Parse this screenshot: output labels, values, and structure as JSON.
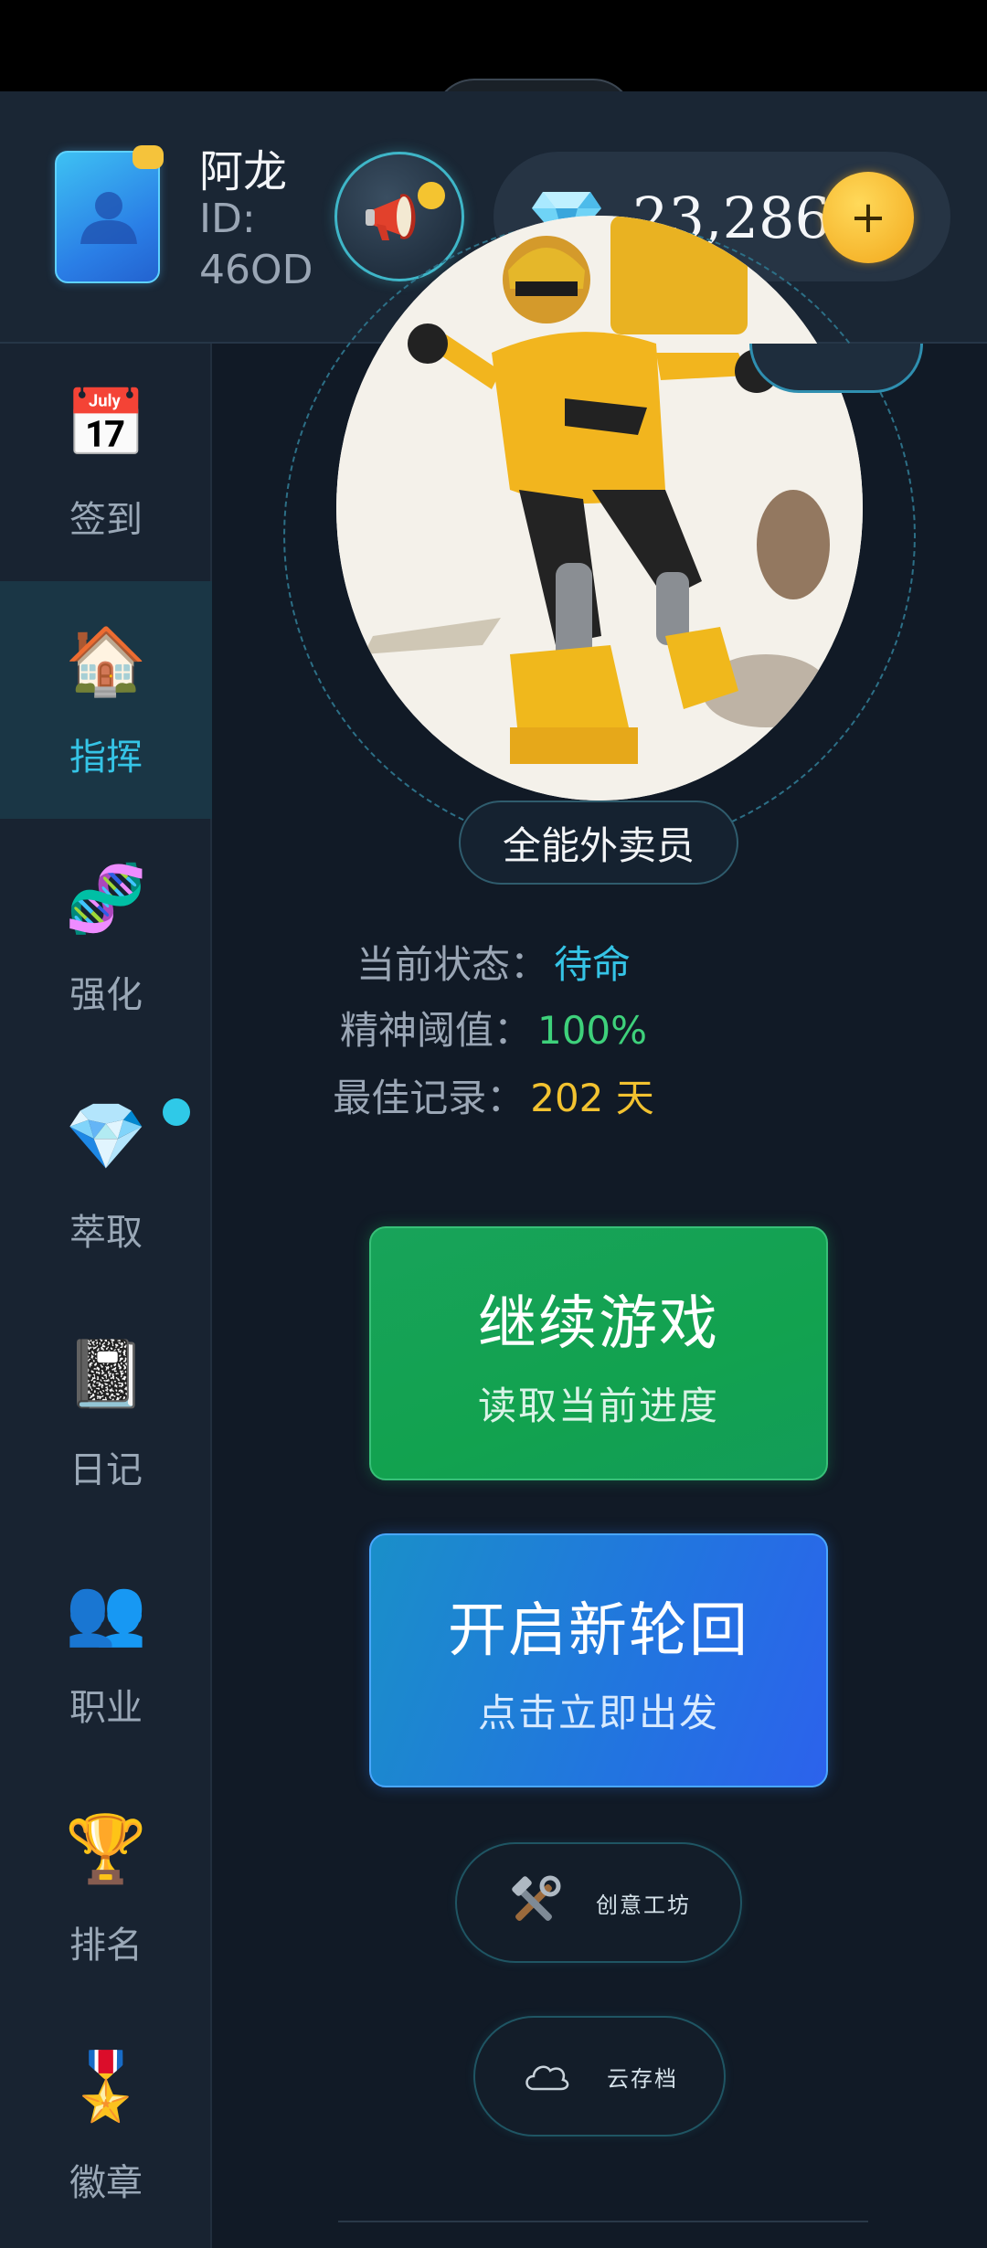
{
  "user": {
    "name": "阿龙",
    "id_label": "ID:",
    "id_value": "46OD"
  },
  "currency": {
    "gems": "23,286",
    "add_label": "+"
  },
  "sidebar": {
    "items": [
      {
        "label": "签到",
        "icon": "calendar-icon",
        "glyph": "📅"
      },
      {
        "label": "指挥",
        "icon": "house-icon",
        "glyph": "🏠",
        "active": true
      },
      {
        "label": "强化",
        "icon": "dna-icon",
        "glyph": "🧬"
      },
      {
        "label": "萃取",
        "icon": "diamond-icon",
        "glyph": "💎",
        "has_dot": true
      },
      {
        "label": "日记",
        "icon": "notebook-icon",
        "glyph": "📓"
      },
      {
        "label": "职业",
        "icon": "people-icon",
        "glyph": "👥"
      },
      {
        "label": "排名",
        "icon": "trophy-icon",
        "glyph": "🏆"
      },
      {
        "label": "徽章",
        "icon": "medal-icon",
        "glyph": "🎖️"
      }
    ]
  },
  "character": {
    "class_name": "全能外卖员"
  },
  "stats": [
    {
      "label": "当前状态：",
      "value": "待命",
      "color": "#35c4e6"
    },
    {
      "label": "精神阈值：",
      "value": "100%",
      "color": "#3ed17b"
    },
    {
      "label": "最佳记录：",
      "value": "202 天",
      "color": "#f2c230"
    }
  ],
  "actions": {
    "continue": {
      "title": "继续游戏",
      "subtitle": "读取当前进度"
    },
    "new_cycle": {
      "title": "开启新轮回",
      "subtitle": "点击立即出发"
    },
    "workshop": {
      "label": "创意工坊",
      "icon": "tools-icon"
    },
    "cloud_save": {
      "label": "云存档",
      "icon": "cloud-icon"
    }
  },
  "colors": {
    "accent": "#35c4e6",
    "green": "#18a35a",
    "blue": "#2274e0",
    "gold": "#f2a81b"
  }
}
